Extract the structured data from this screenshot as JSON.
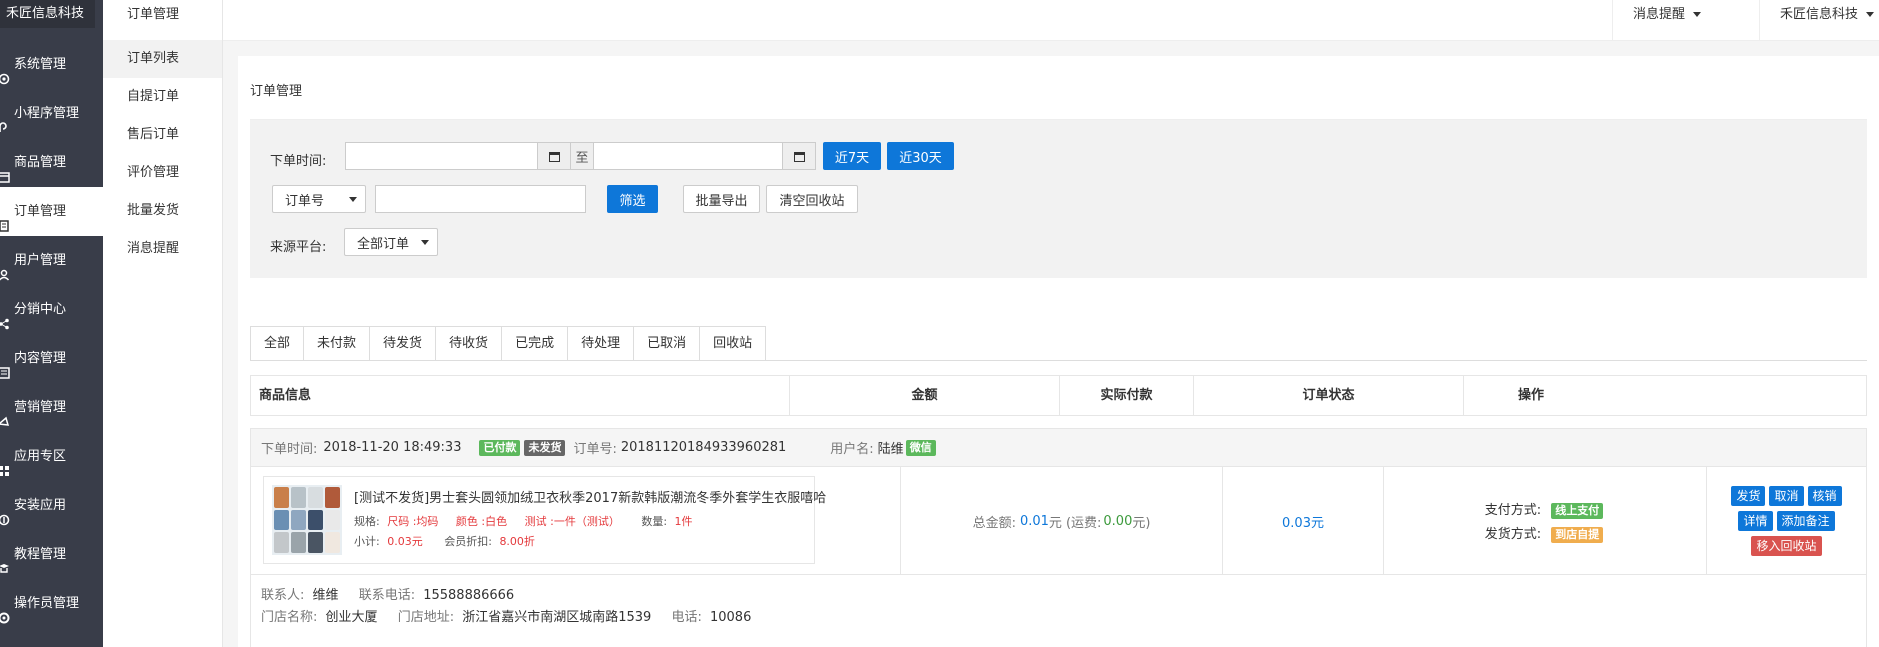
{
  "brand": "禾匠信息科技",
  "nav": [
    {
      "label": "系统管理",
      "icon": "gear-icon"
    },
    {
      "label": "小程序管理",
      "icon": "miniapp-icon"
    },
    {
      "label": "商品管理",
      "icon": "goods-icon"
    },
    {
      "label": "订单管理",
      "icon": "order-icon",
      "active": true
    },
    {
      "label": "用户管理",
      "icon": "user-icon"
    },
    {
      "label": "分销中心",
      "icon": "share-icon"
    },
    {
      "label": "内容管理",
      "icon": "content-icon"
    },
    {
      "label": "营销管理",
      "icon": "marketing-icon"
    },
    {
      "label": "应用专区",
      "icon": "apps-icon"
    },
    {
      "label": "安装应用",
      "icon": "install-icon"
    },
    {
      "label": "教程管理",
      "icon": "tutorial-icon"
    },
    {
      "label": "操作员管理",
      "icon": "operator-icon"
    }
  ],
  "sub": {
    "title": "订单管理",
    "items": [
      "订单列表",
      "自提订单",
      "售后订单",
      "评价管理",
      "批量发货",
      "消息提醒"
    ]
  },
  "header": {
    "msg": "消息提醒",
    "user": "禾匠信息科技"
  },
  "page": {
    "title": "订单管理"
  },
  "filter": {
    "time_label": "下单时间:",
    "to": "至",
    "btn_7": "近7天",
    "btn_30": "近30天",
    "search_type": "订单号",
    "btn_search": "筛选",
    "btn_export": "批量导出",
    "btn_clear": "清空回收站",
    "platform_label": "来源平台:",
    "platform_value": "全部订单"
  },
  "tabs": [
    "全部",
    "未付款",
    "待发货",
    "待收货",
    "已完成",
    "待处理",
    "已取消",
    "回收站"
  ],
  "table_headers": [
    "商品信息",
    "金额",
    "实际付款",
    "订单状态",
    "操作"
  ],
  "order": {
    "time_label": "下单时间:",
    "time": "2018-11-20 18:49:33",
    "badge_paid": "已付款",
    "badge_unsent": "未发货",
    "no_label": "订单号:",
    "no": "20181120184933960281",
    "user_label": "用户名:",
    "user": "陆维",
    "user_badge": "微信",
    "goods_name": "[测试不发货]男士套头圆领加绒卫衣秋季2017新款韩版潮流冬季外套学生衣服嘻哈",
    "spec_label": "规格:",
    "spec_size": "尺码 :均码",
    "spec_color": "颜色 :白色",
    "spec_test": "测试 :一件（测试）",
    "qty_label": "数量:",
    "qty": "1件",
    "subtotal_label": "小计:",
    "subtotal": "0.03元",
    "discount_label": "会员折扣:",
    "discount": "8.00折",
    "total_label": "总金额:",
    "total": "0.01",
    "yuan": "元",
    "freight_label": "(运费:",
    "freight": "0.00",
    "freight_end": "元)",
    "paid": "0.03元",
    "pay_label": "支付方式:",
    "pay_badge": "线上支付",
    "ship_label": "发货方式:",
    "ship_badge": "到店自提",
    "actions": [
      "发货",
      "取消",
      "核销",
      "详情",
      "添加备注"
    ],
    "recycle": "移入回收站",
    "contact_label": "联系人:",
    "contact": "维维",
    "phone_label": "联系电话:",
    "phone": "15588886666",
    "store_label": "门店名称:",
    "store": "创业大厦",
    "addr_label": "门店地址:",
    "addr": "浙江省嘉兴市南湖区城南路1539",
    "tel_label": "电话:",
    "tel": "10086"
  },
  "colors": {
    "sidebar": "#393d49",
    "accent": "#0e77d9",
    "paid_badge": "#5cb85c",
    "unsent_badge": "#666666",
    "pay_badge": "#5cb85c",
    "ship_badge": "#f0ad4e",
    "recycle": "#d9534f"
  }
}
